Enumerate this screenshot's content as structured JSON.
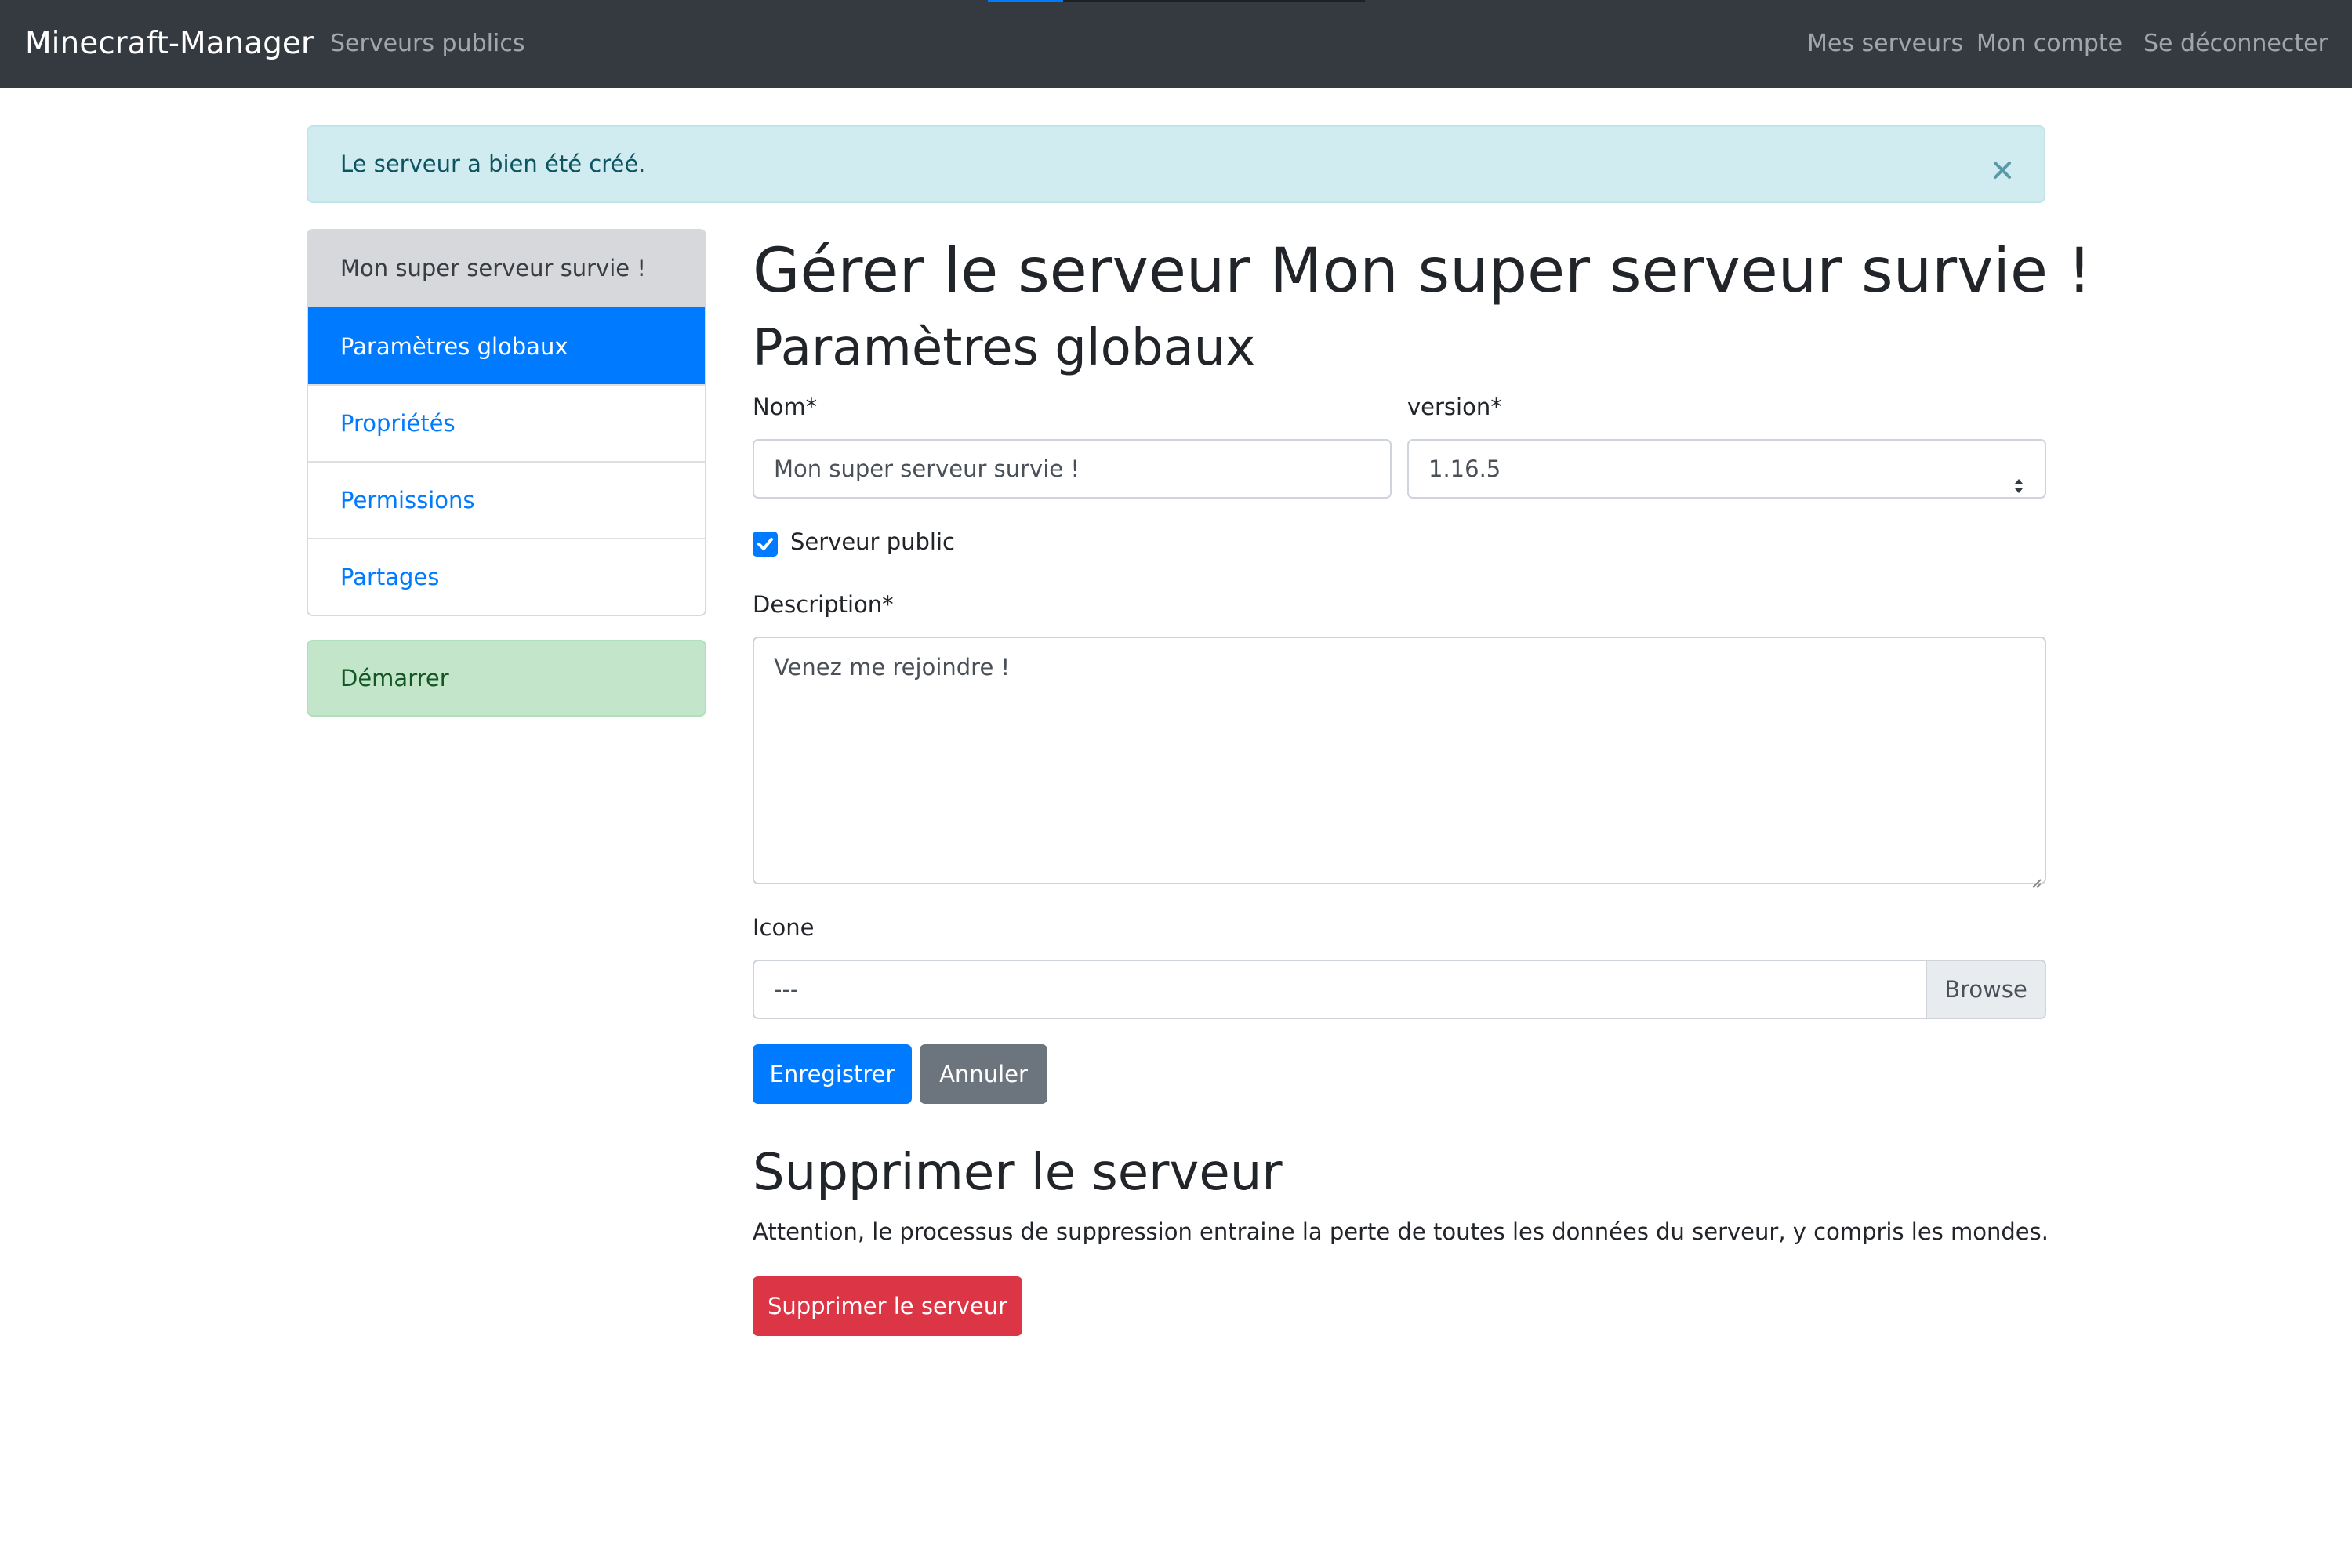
{
  "navbar": {
    "brand": "Minecraft-Manager",
    "left_links": [
      {
        "label": "Serveurs publics"
      }
    ],
    "right_links": [
      {
        "label": "Mes serveurs"
      },
      {
        "label": "Mon compte"
      },
      {
        "label": "Se déconnecter"
      }
    ]
  },
  "alert": {
    "message": "Le serveur a bien été créé.",
    "close_icon": "close-icon"
  },
  "sidebar": {
    "items": [
      {
        "label": "Mon super serveur survie !",
        "state": "header"
      },
      {
        "label": "Paramètres globaux",
        "state": "active"
      },
      {
        "label": "Propriétés",
        "state": "link"
      },
      {
        "label": "Permissions",
        "state": "link"
      },
      {
        "label": "Partages",
        "state": "link"
      }
    ],
    "start_button": "Démarrer"
  },
  "main": {
    "title": "Gérer le serveur Mon super serveur survie !",
    "section_title": "Paramètres globaux",
    "form": {
      "name_label": "Nom*",
      "name_value": "Mon super serveur survie !",
      "version_label": "version*",
      "version_value": "1.16.5",
      "public_label": "Serveur public",
      "public_checked": true,
      "description_label": "Description*",
      "description_value": "Venez me rejoindre !",
      "icon_label": "Icone",
      "icon_value": "---",
      "browse_label": "Browse",
      "save_label": "Enregistrer",
      "cancel_label": "Annuler"
    },
    "delete_section": {
      "title": "Supprimer le serveur",
      "warning": "Attention, le processus de suppression entraine la perte de toutes les données du serveur, y compris les mondes.",
      "button_label": "Supprimer le serveur"
    }
  },
  "colors": {
    "navbar": "#343a40",
    "primary": "#007bff",
    "secondary": "#6c757d",
    "danger": "#dc3545",
    "success_bg": "#c3e6cb",
    "alert_bg": "#d1ecf1"
  }
}
